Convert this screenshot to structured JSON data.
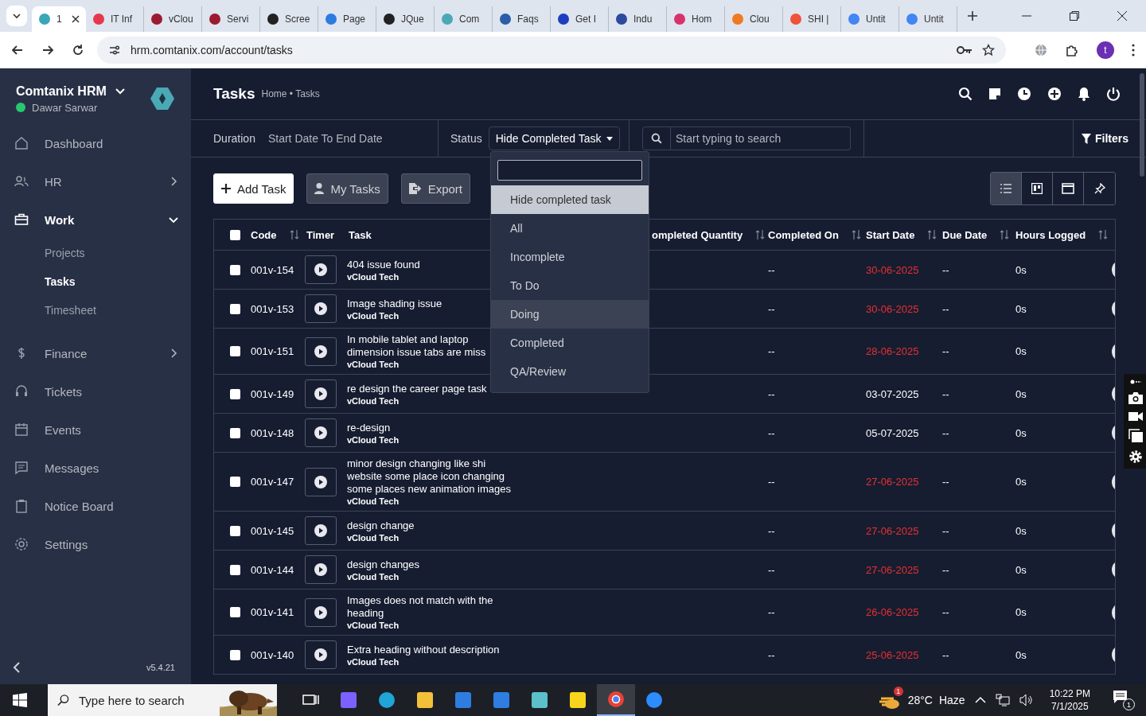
{
  "browser": {
    "tabs": [
      {
        "title": "1",
        "selected": true,
        "color": "#3aa7b8"
      },
      {
        "title": "IT Inf",
        "selected": false,
        "color": "#e5384f"
      },
      {
        "title": "vClou",
        "selected": false,
        "color": "#9b1b30"
      },
      {
        "title": "Servi",
        "selected": false,
        "color": "#9b1b30"
      },
      {
        "title": "Scree",
        "selected": false,
        "color": "#222222"
      },
      {
        "title": "Page",
        "selected": false,
        "color": "#2d7be0"
      },
      {
        "title": "JQue",
        "selected": false,
        "color": "#222222"
      },
      {
        "title": "Com",
        "selected": false,
        "color": "#4aa9b5"
      },
      {
        "title": "Faqs",
        "selected": false,
        "color": "#2b5ea8"
      },
      {
        "title": "Get I",
        "selected": false,
        "color": "#1d3fbf"
      },
      {
        "title": "Indu",
        "selected": false,
        "color": "#2b4aa0"
      },
      {
        "title": "Hom",
        "selected": false,
        "color": "#d6336c"
      },
      {
        "title": "Clou",
        "selected": false,
        "color": "#f07a22"
      },
      {
        "title": "SHI |",
        "selected": false,
        "color": "#f0533a"
      },
      {
        "title": "Untit",
        "selected": false,
        "color": "#4285f4"
      },
      {
        "title": "Untit",
        "selected": false,
        "color": "#4285f4"
      }
    ],
    "url": "hrm.comtanix.com/account/tasks",
    "profile": "t"
  },
  "sidebar": {
    "brand": "Comtanix HRM",
    "user": "Dawar Sarwar",
    "online": true,
    "version": "v5.4.21",
    "items": [
      {
        "label": "Dashboard",
        "selected": false
      },
      {
        "label": "HR",
        "selected": false,
        "expanded": false
      },
      {
        "label": "Work",
        "selected": true,
        "expanded": true,
        "children": [
          {
            "label": "Projects",
            "selected": false
          },
          {
            "label": "Tasks",
            "selected": true
          },
          {
            "label": "Timesheet",
            "selected": false
          }
        ]
      },
      {
        "label": "Finance",
        "selected": false,
        "expanded": false
      },
      {
        "label": "Tickets",
        "selected": false
      },
      {
        "label": "Events",
        "selected": false
      },
      {
        "label": "Messages",
        "selected": false
      },
      {
        "label": "Notice Board",
        "selected": false
      },
      {
        "label": "Settings",
        "selected": false
      }
    ]
  },
  "header": {
    "title": "Tasks",
    "breadcrumb": "Home • Tasks"
  },
  "filters": {
    "duration_label": "Duration",
    "duration_value": "Start Date To End Date",
    "status_label": "Status",
    "status_value": "Hide Completed Task",
    "search_placeholder": "Start typing to search",
    "filters_button": "Filters"
  },
  "status_dropdown": {
    "open": true,
    "options": [
      {
        "label": "Hide completed task",
        "selected": true,
        "highlighted": false
      },
      {
        "label": "All",
        "selected": false,
        "highlighted": false
      },
      {
        "label": "Incomplete",
        "selected": false,
        "highlighted": false
      },
      {
        "label": "To Do",
        "selected": false,
        "highlighted": false
      },
      {
        "label": "Doing",
        "selected": false,
        "highlighted": true
      },
      {
        "label": "Completed",
        "selected": false,
        "highlighted": false
      },
      {
        "label": "QA/Review",
        "selected": false,
        "highlighted": false
      }
    ]
  },
  "actions": [
    {
      "label": "Add Task",
      "kind": "primary"
    },
    {
      "label": "My Tasks",
      "kind": "secondary"
    },
    {
      "label": "Export",
      "kind": "secondary"
    }
  ],
  "view_toggles": [
    {
      "selected": true
    },
    {
      "selected": false
    },
    {
      "selected": false
    },
    {
      "selected": false
    }
  ],
  "table": {
    "all_checked": false,
    "columns": [
      {
        "label": "Code",
        "sortable": true
      },
      {
        "label": "Timer",
        "sortable": false
      },
      {
        "label": "Task",
        "sortable": false
      },
      {
        "label": "ompleted Quantity",
        "sortable": true
      },
      {
        "label": "Completed On",
        "sortable": true
      },
      {
        "label": "Start Date",
        "sortable": true
      },
      {
        "label": "Due Date",
        "sortable": true
      },
      {
        "label": "Hours Logged",
        "sortable": true
      }
    ],
    "rows": [
      {
        "checked": false,
        "code": "001v-154",
        "task": "404 issue found",
        "project": "vCloud Tech",
        "completed_on": "--",
        "start_date": "30-06-2025",
        "overdue": true,
        "due_date": "--",
        "hours_logged": "0s"
      },
      {
        "checked": false,
        "code": "001v-153",
        "task": "Image shading issue",
        "project": "vCloud Tech",
        "completed_on": "--",
        "start_date": "30-06-2025",
        "overdue": true,
        "due_date": "--",
        "hours_logged": "0s"
      },
      {
        "checked": false,
        "code": "001v-151",
        "task": "In mobile tablet and laptop\ndimension issue tabs are miss",
        "project": "vCloud Tech",
        "completed_on": "--",
        "start_date": "28-06-2025",
        "overdue": true,
        "due_date": "--",
        "hours_logged": "0s"
      },
      {
        "checked": false,
        "code": "001v-149",
        "task": "re design the career page task",
        "project": "vCloud Tech",
        "completed_on": "--",
        "start_date": "03-07-2025",
        "overdue": false,
        "due_date": "--",
        "hours_logged": "0s"
      },
      {
        "checked": false,
        "code": "001v-148",
        "task": "re-design",
        "project": "vCloud Tech",
        "completed_on": "--",
        "start_date": "05-07-2025",
        "overdue": false,
        "due_date": "--",
        "hours_logged": "0s"
      },
      {
        "checked": false,
        "code": "001v-147",
        "task": "minor design changing like shi\nwebsite some place icon changing\nsome places new animation images",
        "project": "vCloud Tech",
        "completed_on": "--",
        "start_date": "27-06-2025",
        "overdue": true,
        "due_date": "--",
        "hours_logged": "0s"
      },
      {
        "checked": false,
        "code": "001v-145",
        "task": "design change",
        "project": "vCloud Tech",
        "completed_on": "--",
        "start_date": "27-06-2025",
        "overdue": true,
        "due_date": "--",
        "hours_logged": "0s"
      },
      {
        "checked": false,
        "code": "001v-144",
        "task": "design changes",
        "project": "vCloud Tech",
        "completed_on": "--",
        "start_date": "27-06-2025",
        "overdue": true,
        "due_date": "--",
        "hours_logged": "0s"
      },
      {
        "checked": false,
        "code": "001v-141",
        "task": "Images does not match with the\nheading",
        "project": "vCloud Tech",
        "completed_on": "--",
        "start_date": "26-06-2025",
        "overdue": true,
        "due_date": "--",
        "hours_logged": "0s"
      },
      {
        "checked": false,
        "code": "001v-140",
        "task": "Extra heading without description",
        "project": "vCloud Tech",
        "completed_on": "--",
        "start_date": "25-06-2025",
        "overdue": true,
        "due_date": "--",
        "hours_logged": "0s"
      }
    ]
  },
  "taskbar": {
    "search_placeholder": "Type here to search",
    "apps": [
      {
        "selected": false
      },
      {
        "selected": false
      },
      {
        "selected": false
      },
      {
        "selected": false
      },
      {
        "selected": false
      },
      {
        "selected": false
      },
      {
        "selected": false
      },
      {
        "selected": false
      },
      {
        "selected": true
      },
      {
        "selected": false
      }
    ],
    "weather": {
      "temperature": "28°C",
      "condition": "Haze",
      "badge": "1"
    },
    "time": "10:22 PM",
    "date": "7/1/2025",
    "notifications": "1"
  }
}
